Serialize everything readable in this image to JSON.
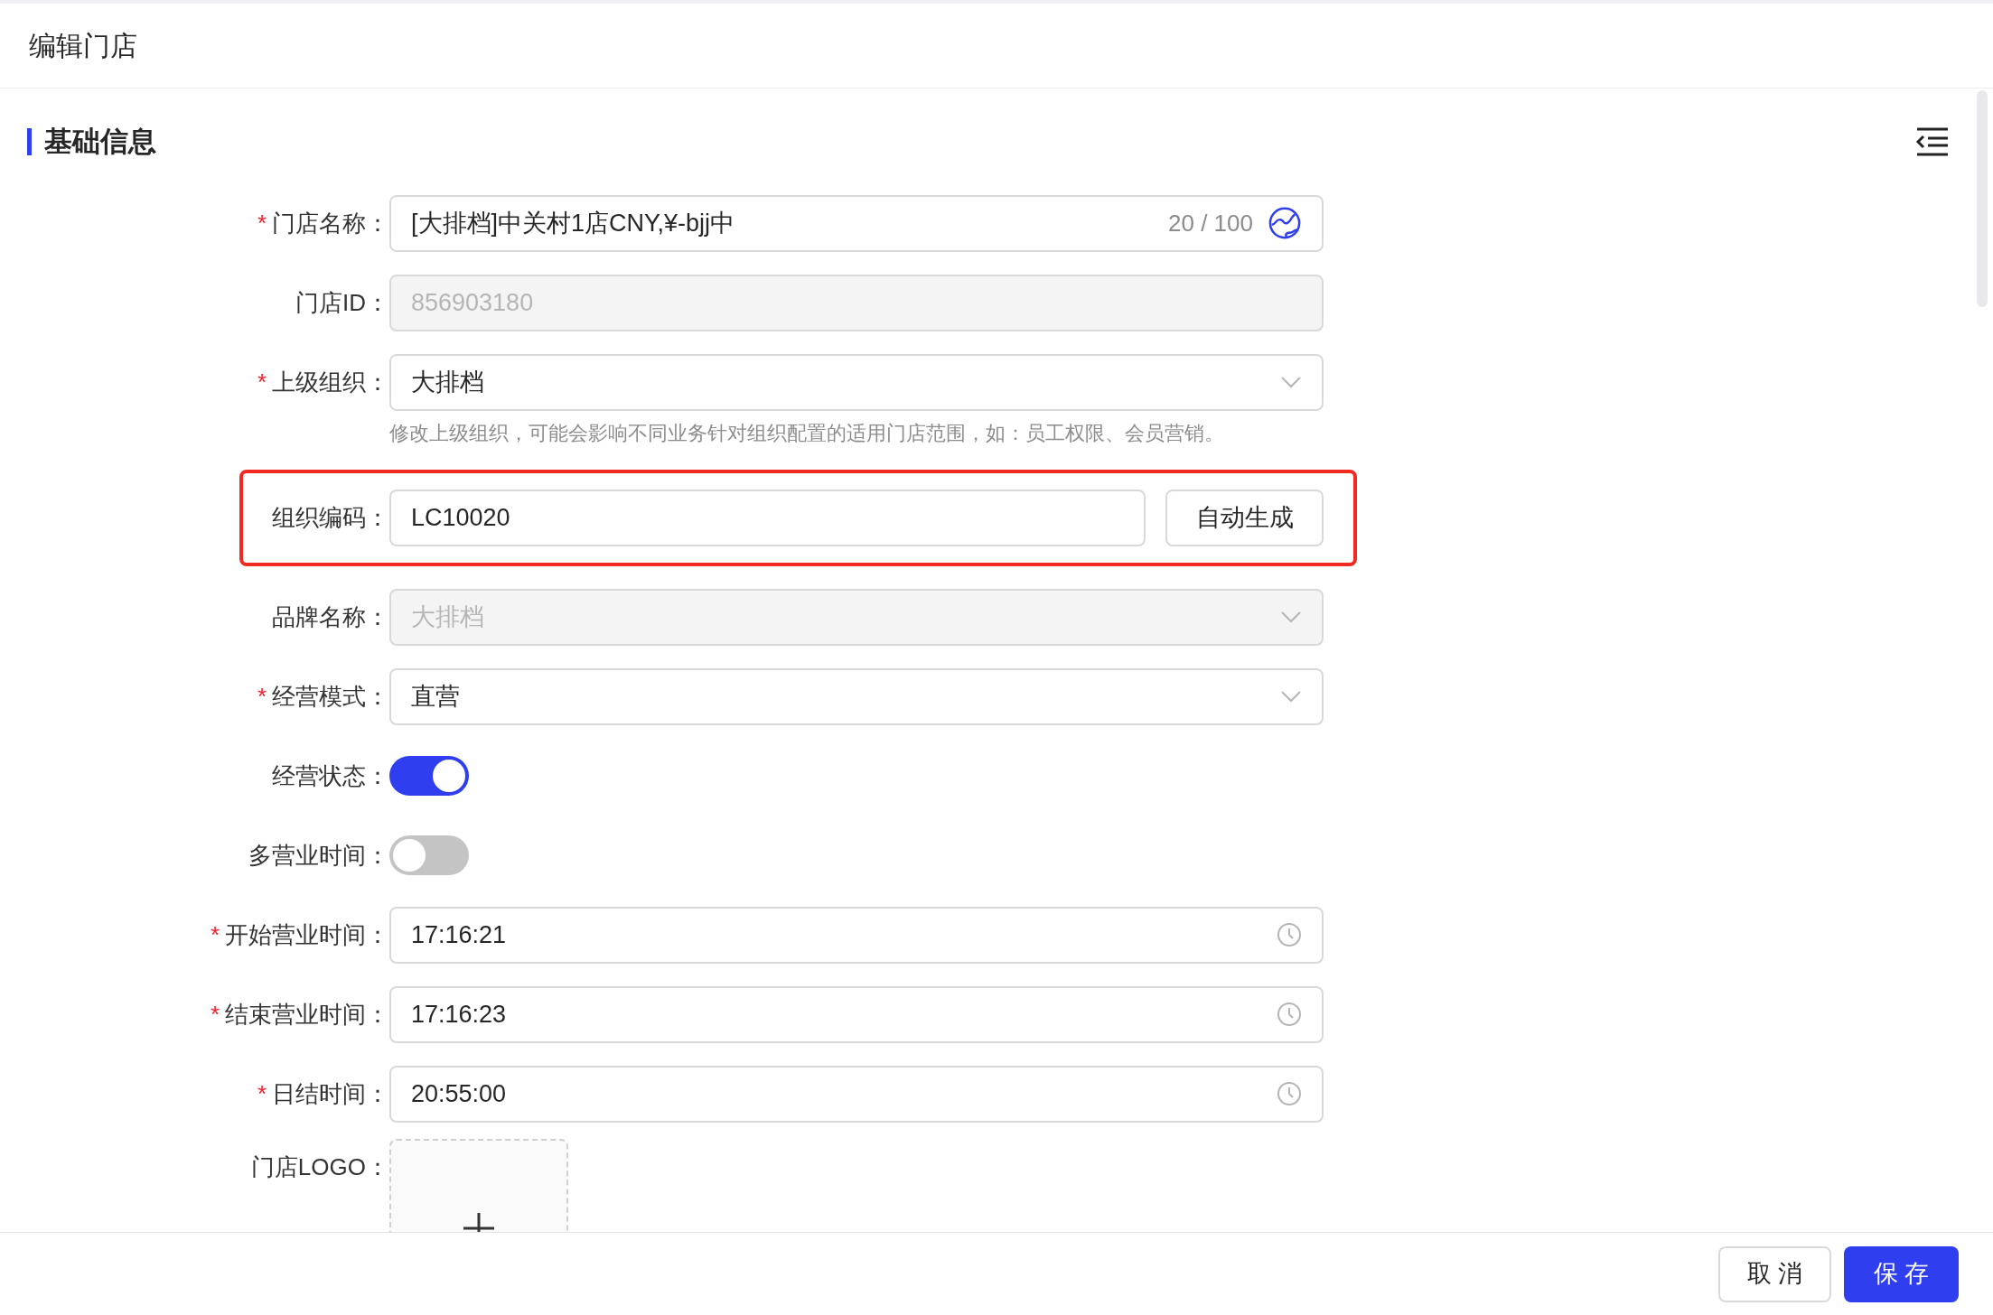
{
  "header": {
    "title": "编辑门店"
  },
  "section": {
    "title": "基础信息"
  },
  "fields": [
    {
      "kind": "text",
      "label": "门店名称：",
      "required_mark": "*",
      "value": "[大排档]中关村1店CNY,¥-bjj中",
      "counter": "20 / 100"
    },
    {
      "kind": "readonly",
      "label": "门店ID：",
      "placeholder": "856903180"
    },
    {
      "kind": "select",
      "label": "上级组织：",
      "required_mark": "*",
      "value": "大排档",
      "disabled": false,
      "hint": "修改上级组织，可能会影响不同业务针对组织配置的适用门店范围，如：员工权限、会员营销。"
    },
    {
      "kind": "code",
      "label": "组织编码：",
      "value": "LC10020",
      "button": "自动生成",
      "highlighted": true
    },
    {
      "kind": "select",
      "label": "品牌名称：",
      "value": "大排档",
      "disabled": true
    },
    {
      "kind": "select",
      "label": "经营模式：",
      "required_mark": "*",
      "value": "直营",
      "disabled": false
    },
    {
      "kind": "switch",
      "label": "经营状态：",
      "on": true
    },
    {
      "kind": "switch",
      "label": "多营业时间：",
      "on": false
    },
    {
      "kind": "time",
      "label": "开始营业时间：",
      "required_mark": "*",
      "value": "17:16:21"
    },
    {
      "kind": "time",
      "label": "结束营业时间：",
      "required_mark": "*",
      "value": "17:16:23"
    },
    {
      "kind": "time",
      "label": "日结时间：",
      "required_mark": "*",
      "value": "20:55:00"
    },
    {
      "kind": "upload",
      "label": "门店LOGO："
    }
  ],
  "footer": {
    "buttons": [
      {
        "label": "取 消",
        "kind": "secondary"
      },
      {
        "label": "保 存",
        "kind": "primary"
      }
    ]
  }
}
